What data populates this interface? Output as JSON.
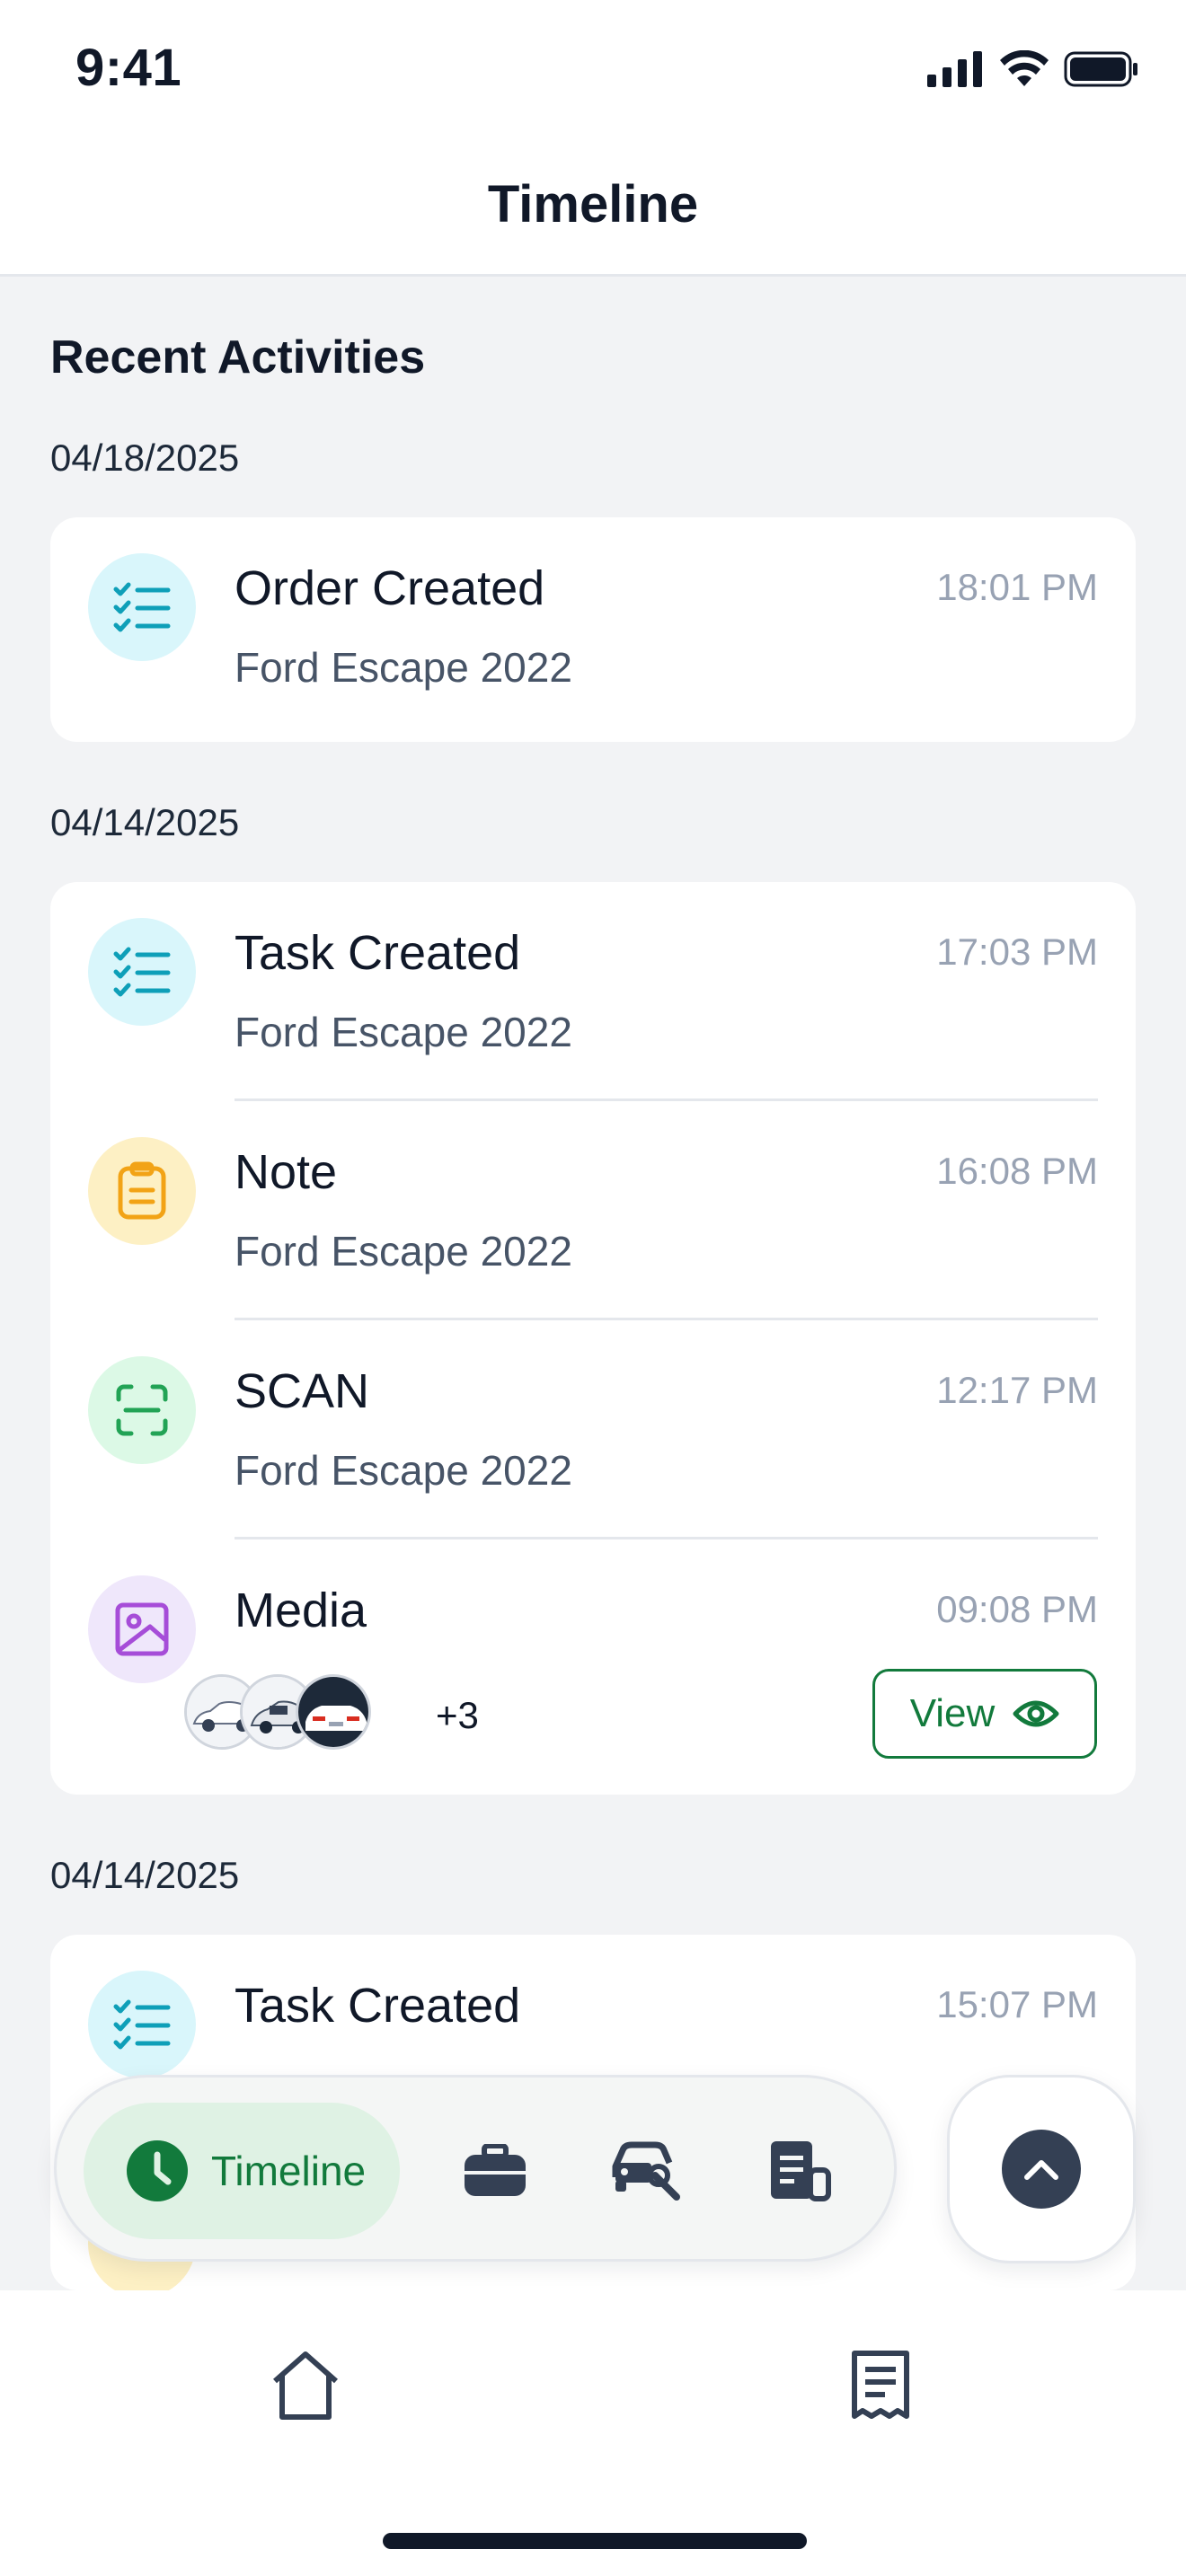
{
  "status_bar": {
    "time": "9:41"
  },
  "header": {
    "title": "Timeline"
  },
  "section_title": "Recent Activities",
  "groups": [
    {
      "date": "04/18/2025",
      "entries": [
        {
          "title": "Order Created",
          "subtitle": "Ford Escape 2022",
          "time": "18:01 PM",
          "icon": "checklist-icon",
          "color": "#0e9fb8"
        }
      ]
    },
    {
      "date": "04/14/2025",
      "entries": [
        {
          "title": "Task Created",
          "subtitle": "Ford Escape 2022",
          "time": "17:03 PM",
          "icon": "checklist-icon",
          "color": "#0e9fb8"
        },
        {
          "title": "Note",
          "subtitle": "Ford Escape 2022",
          "time": "16:08 PM",
          "icon": "clipboard-icon",
          "color": "#f2a316"
        },
        {
          "title": "SCAN",
          "subtitle": "Ford Escape 2022",
          "time": "12:17 PM",
          "icon": "scan-icon",
          "color": "#22a355"
        },
        {
          "title": "Media",
          "time": "09:08 PM",
          "icon": "image-icon",
          "color": "#a64dd8",
          "more_count": "+3",
          "view_label": "View"
        }
      ]
    },
    {
      "date": "04/14/2025",
      "entries": [
        {
          "title": "Task Created",
          "time": "15:07 PM",
          "icon": "checklist-icon",
          "color": "#0e9fb8"
        }
      ]
    }
  ],
  "bottom_pill": {
    "active_label": "Timeline",
    "items": [
      "clock-icon",
      "briefcase-icon",
      "car-wrench-icon",
      "receipt-icon"
    ]
  },
  "tab_bar": {
    "items": [
      "home-icon",
      "receipt-icon"
    ]
  },
  "colors": {
    "accent_green": "#127a3c",
    "active_pill_bg": "#dff2e4"
  }
}
